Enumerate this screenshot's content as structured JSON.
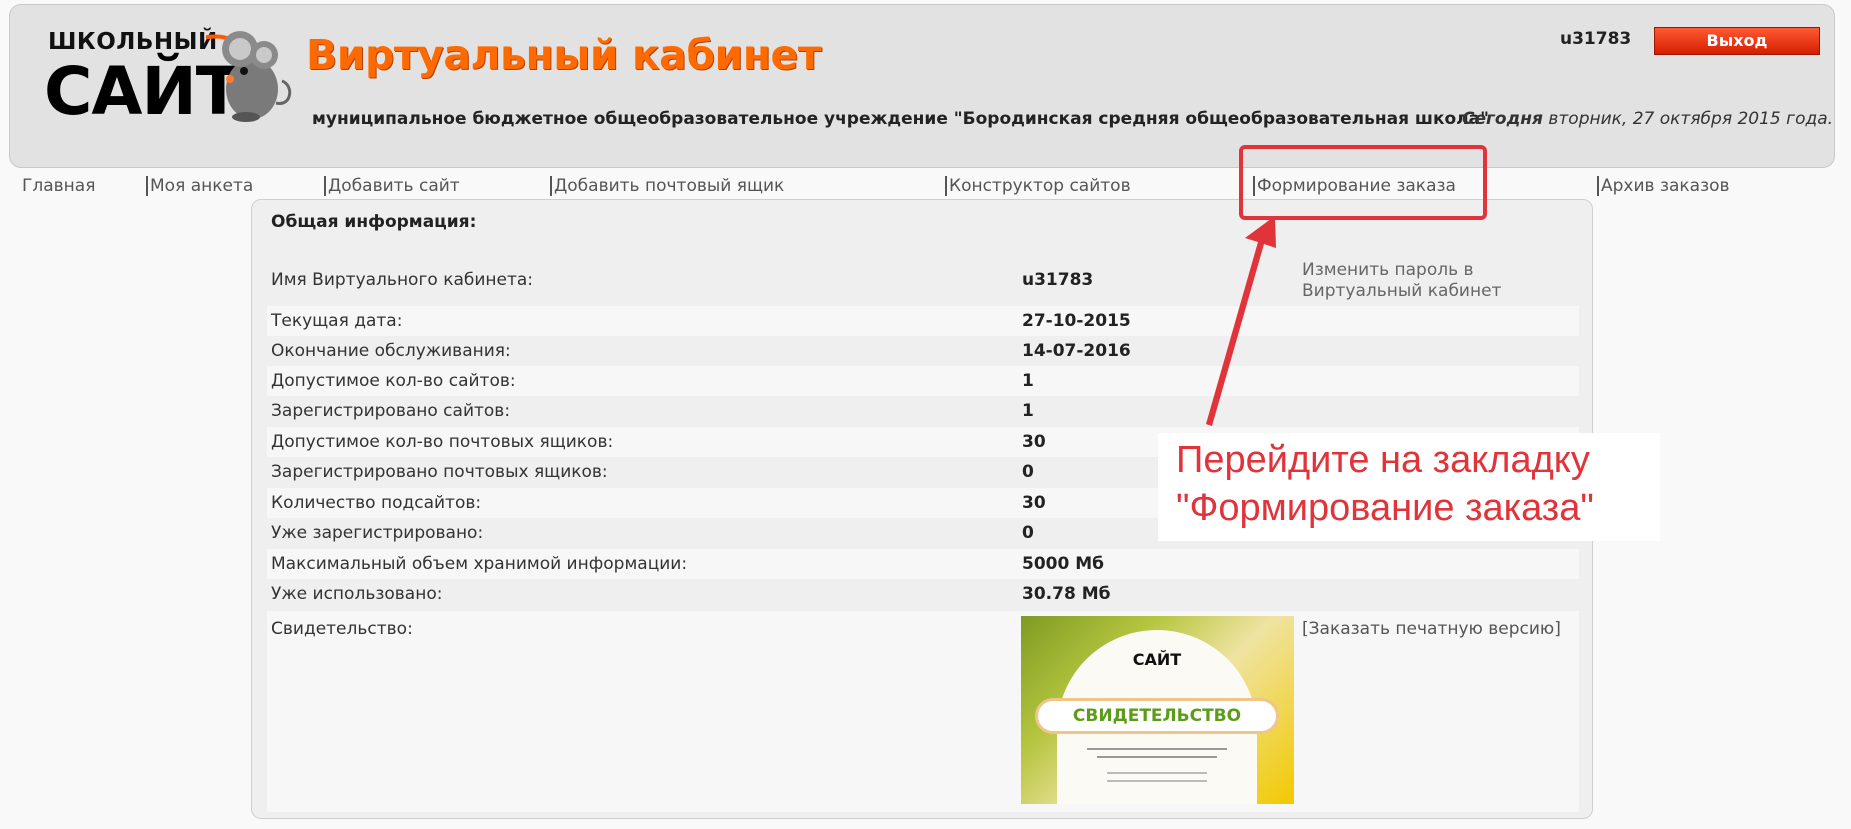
{
  "header": {
    "logo": {
      "top_text": "ШКОЛЬНЫЙ",
      "main_text": "САЙТ"
    },
    "title": "Виртуальный кабинет",
    "school_name": "муниципальное бюджетное общеобразовательное учреждение \"Бородинская средняя общеобразовательная школа\"",
    "today_label": "Сегодня",
    "today_value": "вторник, 27 октября 2015 года.",
    "user_login": "u31783",
    "logout_label": "Выход"
  },
  "nav": {
    "items": [
      {
        "label": "Главная"
      },
      {
        "label": "Моя анкета"
      },
      {
        "label": "Добавить сайт"
      },
      {
        "label": "Добавить почтовый ящик"
      },
      {
        "label": "Конструктор сайтов"
      },
      {
        "label": "Формирование заказа"
      },
      {
        "label": "Архив заказов"
      }
    ]
  },
  "content": {
    "section_title": "Общая информация:",
    "change_password_link": "Изменить пароль в Виртуальный кабинет",
    "rows": [
      {
        "label": "Имя Виртуального кабинета:",
        "value": "u31783"
      },
      {
        "label": "Текущая дата:",
        "value": "27-10-2015"
      },
      {
        "label": "Окончание обслуживания:",
        "value": "14-07-2016"
      },
      {
        "label": "Допустимое кол-во сайтов:",
        "value": "1"
      },
      {
        "label": "Зарегистрировано сайтов:",
        "value": "1"
      },
      {
        "label": "Допустимое кол-во почтовых ящиков:",
        "value": "30"
      },
      {
        "label": "Зарегистрировано почтовых ящиков:",
        "value": "0"
      },
      {
        "label": "Количество подсайтов:",
        "value": "30"
      },
      {
        "label": "Уже зарегистрировано:",
        "value": "0"
      },
      {
        "label": "Максимальный объем хранимой информации:",
        "value": "5000 Мб"
      },
      {
        "label": "Уже использовано:",
        "value": "30.78 Мб"
      }
    ],
    "certificate": {
      "label": "Свидетельство:",
      "image_logo_text": "САЙТ",
      "image_banner_text": "СВИДЕТЕЛЬСТВО",
      "order_print_link": "[Заказать печатную версию]"
    }
  },
  "annotation": {
    "line1": "Перейдите на закладку",
    "line2": "\"Формирование заказа\"",
    "color": "#e0333a"
  },
  "colors": {
    "accent_orange": "#ff6a00",
    "logout_red": "#e02a00",
    "header_bg": "#e2e2e2"
  }
}
